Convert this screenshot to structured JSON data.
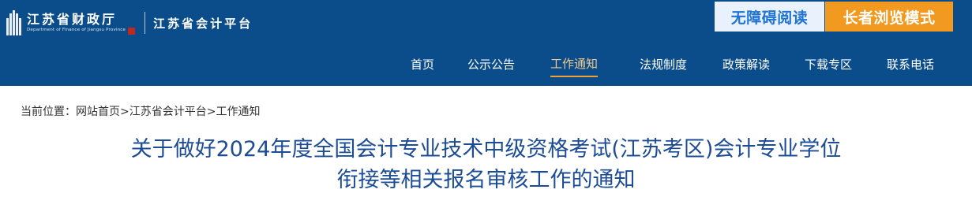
{
  "header": {
    "logo_cn": "江苏省财政厅",
    "logo_en": "Department of Finance of Jiangsu Province",
    "sub_title": "江苏省会计平台"
  },
  "accessibility": {
    "a11y_label": "无障碍阅读",
    "elder_label": "长者浏览模式"
  },
  "nav": {
    "items": [
      "首页",
      "公示公告",
      "工作通知",
      "法规制度",
      "政策解读",
      "下载专区",
      "联系电话"
    ],
    "active": "工作通知"
  },
  "breadcrumb": {
    "prefix": "当前位置：",
    "items": [
      "网站首页",
      "江苏省会计平台",
      "工作通知"
    ],
    "separator": ">"
  },
  "article": {
    "title_line1": "关于做好2024年度全国会计专业技术中级资格考试(江苏考区)会计专业学位",
    "title_line2": "衔接等相关报名审核工作的通知"
  },
  "colors": {
    "header_bg": "#0a4d8a",
    "title": "#1d4c97",
    "elder_bg": "#f29a20",
    "a11y_bg": "#e9f2fc",
    "a11y_text": "#1f74d3",
    "nav_active": "#f0a23a"
  },
  "icons": {
    "logo_mark": "building-columns-icon",
    "seal": "red-seal-icon"
  }
}
